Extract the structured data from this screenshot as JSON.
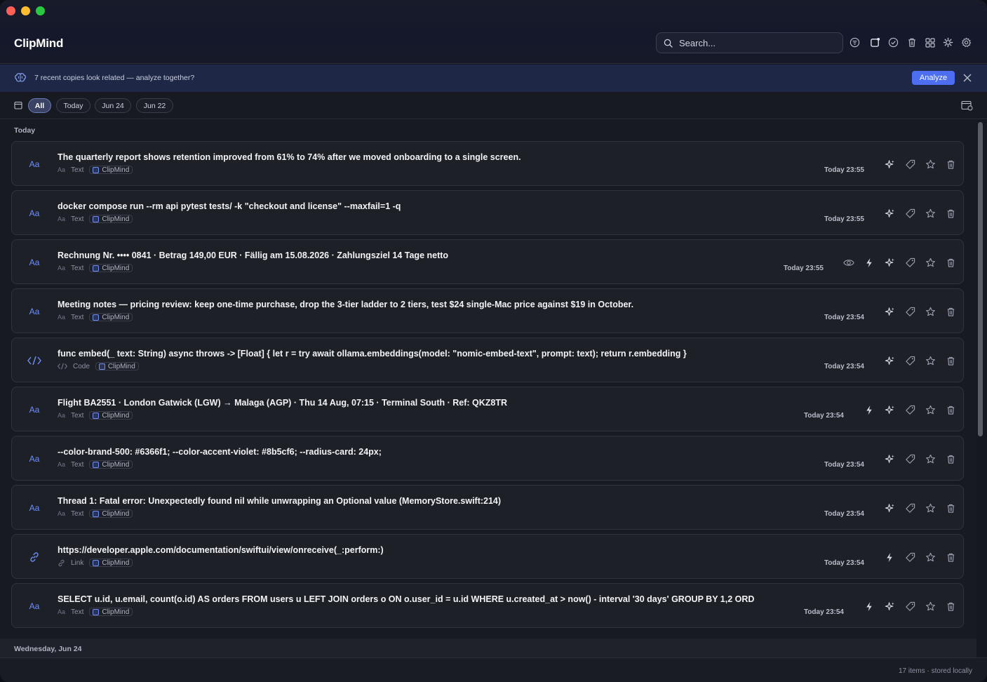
{
  "app": {
    "title": "ClipMind"
  },
  "search": {
    "placeholder": "Search..."
  },
  "header_icons": [
    "filter-list-icon",
    "new-window-icon",
    "check-circle-icon",
    "trash-icon",
    "grid-icon",
    "sparkle-gear-icon",
    "settings-gear-icon"
  ],
  "banner": {
    "text": "7 recent copies look related — analyze together?",
    "button": "Analyze"
  },
  "filters": {
    "chips": [
      "All",
      "Today",
      "Jun 24",
      "Jun 22"
    ],
    "active": "All"
  },
  "sections": {
    "today": "Today",
    "next": "Wednesday, Jun 24"
  },
  "items": [
    {
      "kind": "text",
      "title": "The quarterly report shows retention improved from 61% to 74% after we moved onboarding to a single screen.",
      "type_label": "Text",
      "type_icon": "Aa",
      "app": "ClipMind",
      "time": "Today 23:55",
      "actions": [
        "sparkle",
        "tag",
        "star",
        "trash"
      ]
    },
    {
      "kind": "text",
      "title": "docker compose run --rm api pytest tests/ -k \"checkout and license\" --maxfail=1 -q",
      "type_label": "Text",
      "type_icon": "Aa",
      "app": "ClipMind",
      "time": "Today 23:55",
      "actions": [
        "sparkle",
        "tag",
        "star",
        "trash"
      ]
    },
    {
      "kind": "text",
      "title": "Rechnung Nr. •••• 0841 · Betrag 149,00 EUR · Fällig am 15.08.2026 · Zahlungsziel 14 Tage netto",
      "type_label": "Text",
      "type_icon": "Aa",
      "app": "ClipMind",
      "time": "Today 23:55",
      "actions": [
        "eye",
        "bolt",
        "sparkle",
        "tag",
        "star",
        "trash"
      ]
    },
    {
      "kind": "text",
      "title": "Meeting notes — pricing review: keep one-time purchase, drop the 3-tier ladder to 2 tiers, test $24 single-Mac price against $19 in October.",
      "type_label": "Text",
      "type_icon": "Aa",
      "app": "ClipMind",
      "time": "Today 23:54",
      "actions": [
        "sparkle",
        "tag",
        "star",
        "trash"
      ]
    },
    {
      "kind": "code",
      "title": "func embed(_ text: String) async throws -> [Float] { let r = try await ollama.embeddings(model: \"nomic-embed-text\", prompt: text); return r.embedding }",
      "type_label": "Code",
      "type_icon": "</>",
      "app": "ClipMind",
      "time": "Today 23:54",
      "actions": [
        "sparkle",
        "tag",
        "star",
        "trash"
      ]
    },
    {
      "kind": "text",
      "title": "Flight BA2551 · London Gatwick (LGW) → Malaga (AGP) · Thu 14 Aug, 07:15 · Terminal South · Ref: QKZ8TR",
      "type_label": "Text",
      "type_icon": "Aa",
      "app": "ClipMind",
      "time": "Today 23:54",
      "actions": [
        "bolt",
        "sparkle",
        "tag",
        "star",
        "trash"
      ]
    },
    {
      "kind": "text",
      "title": "--color-brand-500: #6366f1; --color-accent-violet: #8b5cf6; --radius-card: 24px;",
      "type_label": "Text",
      "type_icon": "Aa",
      "app": "ClipMind",
      "time": "Today 23:54",
      "actions": [
        "sparkle",
        "tag",
        "star",
        "trash"
      ]
    },
    {
      "kind": "text",
      "title": "Thread 1: Fatal error: Unexpectedly found nil while unwrapping an Optional value (MemoryStore.swift:214)",
      "type_label": "Text",
      "type_icon": "Aa",
      "app": "ClipMind",
      "time": "Today 23:54",
      "actions": [
        "sparkle",
        "tag",
        "star",
        "trash"
      ]
    },
    {
      "kind": "link",
      "title": "https://developer.apple.com/documentation/swiftui/view/onreceive(_:perform:)",
      "type_label": "Link",
      "type_icon": "link",
      "app": "ClipMind",
      "time": "Today 23:54",
      "actions": [
        "bolt",
        "tag",
        "star",
        "trash"
      ]
    },
    {
      "kind": "text",
      "title": "SELECT u.id, u.email, count(o.id) AS orders FROM users u LEFT JOIN orders o ON o.user_id = u.id WHERE u.created_at > now() - interval '30 days' GROUP BY 1,2 ORD",
      "type_label": "Text",
      "type_icon": "Aa",
      "app": "ClipMind",
      "time": "Today 23:54",
      "actions": [
        "bolt",
        "sparkle",
        "tag",
        "star",
        "trash"
      ]
    }
  ],
  "footer": {
    "status": "17 items · stored locally"
  },
  "colors": {
    "accent": "#4d6ef0",
    "banner_bg": "#1e2746",
    "icon_blue": "#6f8ff5"
  }
}
